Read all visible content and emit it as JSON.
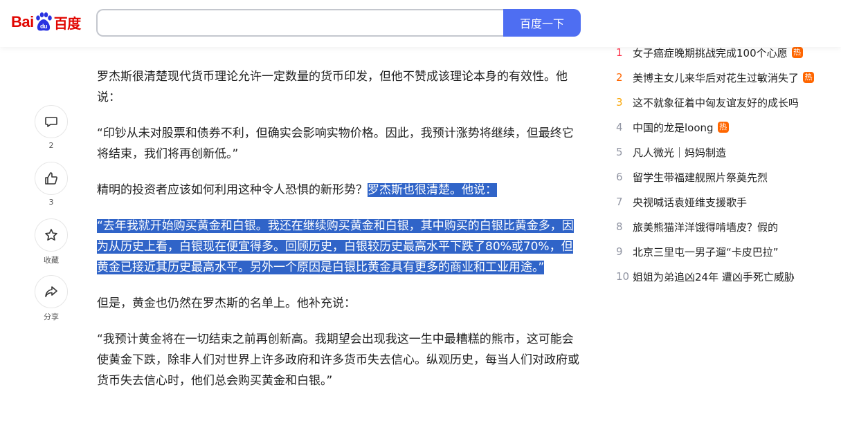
{
  "brand": {
    "logo_latin": "Bai",
    "logo_paw_text": "du",
    "logo_chinese": "百度",
    "logo_color": "#e10601",
    "paw_color": "#2932e1"
  },
  "search": {
    "value": "",
    "placeholder": "",
    "button_label": "百度一下",
    "button_color": "#4e6ef2"
  },
  "actions": [
    {
      "icon": "comment-icon",
      "label": "2"
    },
    {
      "icon": "thumbs-up-icon",
      "label": "3"
    },
    {
      "icon": "star-icon",
      "label": "收藏"
    },
    {
      "icon": "share-icon",
      "label": "分享"
    }
  ],
  "article": {
    "p1": "罗杰斯很清楚现代货币理论允许一定数量的货币印发，但他不赞成该理论本身的有效性。他说：",
    "p2": "“印钞从未对股票和债券不利，但确实会影响实物价格。因此，我预计涨势将继续，但最终它将结束，我们将再创新低。”",
    "p3_plain": "精明的投资者应该如何利用这种令人恐惧的新形势？",
    "p3_selected": "罗杰斯也很清楚。他说：",
    "p4_selected": "“去年我就开始购买黄金和白银。我还在继续购买黄金和白银，其中购买的白银比黄金多，因为从历史上看，白银现在便宜得多。回顾历史，白银较历史最高水平下跌了80%或70%，但黄金已接近其历史最高水平。另外一个原因是白银比黄金具有更多的商业和工业用途。”",
    "p5": "但是，黄金也仍然在罗杰斯的名单上。他补充说：",
    "p6": "“我预计黄金将在一切结束之前再创新高。我期望会出现我这一生中最糟糕的熊市，这可能会使黄金下跌，除非人们对世界上许多政府和许多货币失去信心。纵观历史，每当人们对政府或货币失去信心时，他们总会购买黄金和白银。”",
    "selection_color": "#3064c8"
  },
  "hotlist": [
    {
      "rank": "1",
      "title": "女子癌症晚期挑战完成100个心愿",
      "badge": "热"
    },
    {
      "rank": "2",
      "title": "美博主女儿来华后对花生过敏消失了",
      "badge": "热"
    },
    {
      "rank": "3",
      "title": "这不就象征着中匈友谊友好的成长吗",
      "badge": ""
    },
    {
      "rank": "4",
      "title": "中国的龙是loong",
      "badge": "热"
    },
    {
      "rank": "5",
      "title": "凡人微光｜妈妈制造",
      "badge": ""
    },
    {
      "rank": "6",
      "title": "留学生带福建舰照片祭奠先烈",
      "badge": ""
    },
    {
      "rank": "7",
      "title": "央视喊话袁娅维支援歌手",
      "badge": ""
    },
    {
      "rank": "8",
      "title": "旅美熊猫洋洋饿得啃墙皮？假的",
      "badge": ""
    },
    {
      "rank": "9",
      "title": "北京三里屯一男子遛“卡皮巴拉”",
      "badge": ""
    },
    {
      "rank": "10",
      "title": "姐姐为弟追凶24年 遭凶手死亡威胁",
      "badge": ""
    }
  ],
  "hot_badge_color": "#ff6600"
}
